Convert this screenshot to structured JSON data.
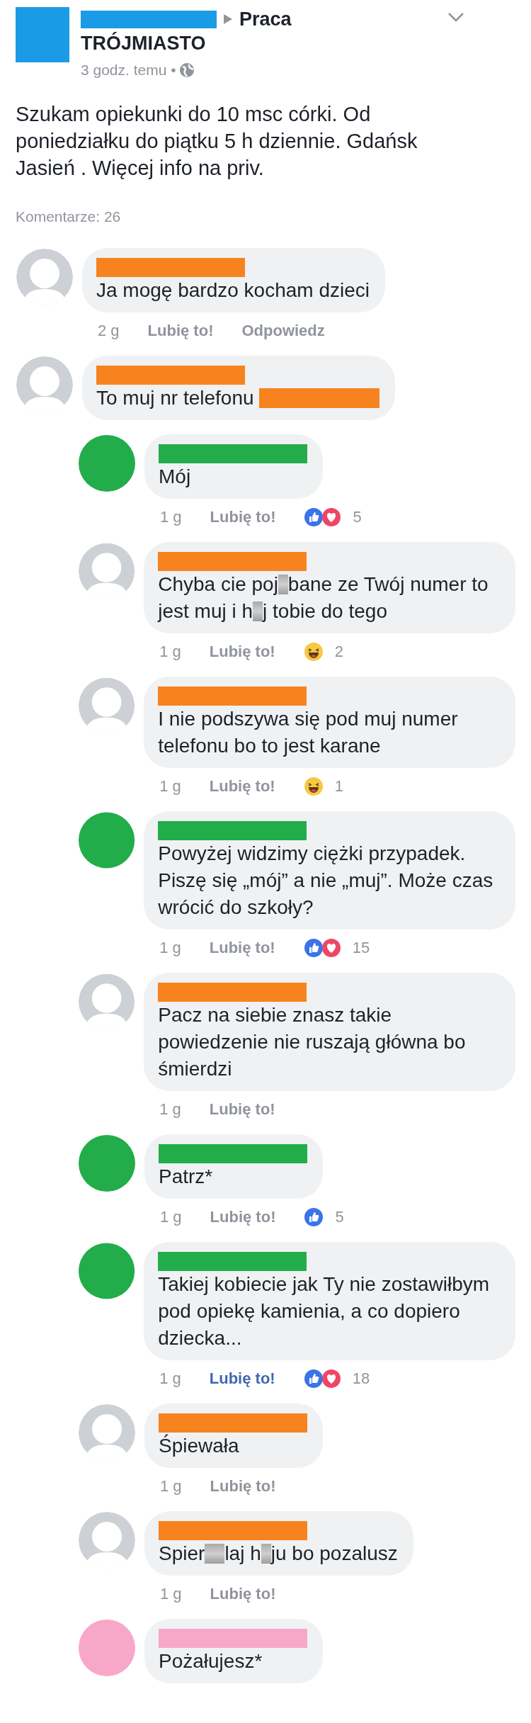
{
  "post": {
    "group_lines": [
      "Praca",
      "TRÓJMIASTO"
    ],
    "time": "3 godz. temu •",
    "text": "Szukam opiekunki do 10 msc córki. Od poniedziałku do piątku 5 h dziennie. Gdańsk Jasień . Więcej info na priv.",
    "comment_count": "Komentarze: 26"
  },
  "comments": [
    {
      "color": "#f7831f",
      "kind": "silhouette",
      "parts": [
        {
          "kind": "text",
          "text": "Ja mogę bardzo kocham dzieci"
        }
      ],
      "time": "2 g",
      "like": "Lubię to!",
      "liked": false,
      "reply": "Odpowiedz"
    },
    {
      "color": "#f7831f",
      "kind": "silhouette",
      "parts": [
        {
          "kind": "text",
          "text": "To muj nr telefonu "
        },
        {
          "kind": "redaction"
        }
      ],
      "children": [
        {
          "color": "#22ad4a",
          "kind": "circle",
          "parts": [
            {
              "kind": "text",
              "text": "Mój"
            }
          ],
          "time": "1 g",
          "like": "Lubię to!",
          "liked": false,
          "reactions": [
            {
              "kind": "like"
            },
            {
              "kind": "love"
            }
          ],
          "reaction_count": "5"
        },
        {
          "color": "#f7831f",
          "kind": "silhouette",
          "parts": [
            {
              "kind": "text",
              "text": "Chyba cie poj"
            },
            {
              "kind": "censor"
            },
            {
              "kind": "text",
              "text": "bane ze Twój numer to jest muj i h"
            },
            {
              "kind": "censor"
            },
            {
              "kind": "text",
              "text": "j tobie do tego"
            }
          ],
          "time": "1 g",
          "like": "Lubię to!",
          "liked": false,
          "reactions": [
            {
              "kind": "haha"
            }
          ],
          "reaction_count": "2"
        },
        {
          "color": "#f7831f",
          "kind": "silhouette",
          "parts": [
            {
              "kind": "text",
              "text": "I nie podszywa się pod muj numer telefonu bo to jest  karane"
            }
          ],
          "time": "1 g",
          "like": "Lubię to!",
          "liked": false,
          "reactions": [
            {
              "kind": "haha"
            }
          ],
          "reaction_count": "1"
        },
        {
          "color": "#22ad4a",
          "kind": "circle",
          "parts": [
            {
              "kind": "text",
              "text": "Powyżej widzimy ciężki przypadek. Piszę się „mój” a nie „muj”. Może czas wrócić do szkoły?"
            }
          ],
          "time": "1 g",
          "like": "Lubię to!",
          "liked": false,
          "reactions": [
            {
              "kind": "like"
            },
            {
              "kind": "love"
            }
          ],
          "reaction_count": "15"
        },
        {
          "color": "#f7831f",
          "kind": "silhouette",
          "parts": [
            {
              "kind": "text",
              "text": "Pacz na siebie znasz takie powiedzenie nie ruszają główna bo śmierdzi"
            }
          ],
          "time": "1 g",
          "like": "Lubię to!",
          "liked": false
        },
        {
          "color": "#22ad4a",
          "kind": "circle",
          "parts": [
            {
              "kind": "text",
              "text": "Patrz*"
            }
          ],
          "time": "1 g",
          "like": "Lubię to!",
          "liked": false,
          "reactions": [
            {
              "kind": "like"
            }
          ],
          "reaction_count": "5"
        },
        {
          "color": "#22ad4a",
          "kind": "circle",
          "parts": [
            {
              "kind": "text",
              "text": "Takiej kobiecie jak Ty nie zostawiłbym pod opiekę kamienia, a co dopiero dziecka..."
            }
          ],
          "time": "1 g",
          "like": "Lubię to!",
          "liked": true,
          "reactions": [
            {
              "kind": "like"
            },
            {
              "kind": "love"
            }
          ],
          "reaction_count": "18"
        },
        {
          "color": "#f7831f",
          "kind": "silhouette",
          "parts": [
            {
              "kind": "text",
              "text": "Śpiewała"
            }
          ],
          "time": "1 g",
          "like": "Lubię to!",
          "liked": false
        },
        {
          "color": "#f7831f",
          "kind": "silhouette",
          "parts": [
            {
              "kind": "text",
              "text": "Spier"
            },
            {
              "kind": "censor"
            },
            {
              "kind": "censor"
            },
            {
              "kind": "text",
              "text": "laj h"
            },
            {
              "kind": "censor"
            },
            {
              "kind": "text",
              "text": "ju bo pozalusz"
            }
          ],
          "time": "1 g",
          "like": "Lubię to!",
          "liked": false
        },
        {
          "color": "#f7a8c8",
          "kind": "circle",
          "parts": [
            {
              "kind": "text",
              "text": "Pożałujesz*"
            }
          ]
        }
      ]
    }
  ]
}
